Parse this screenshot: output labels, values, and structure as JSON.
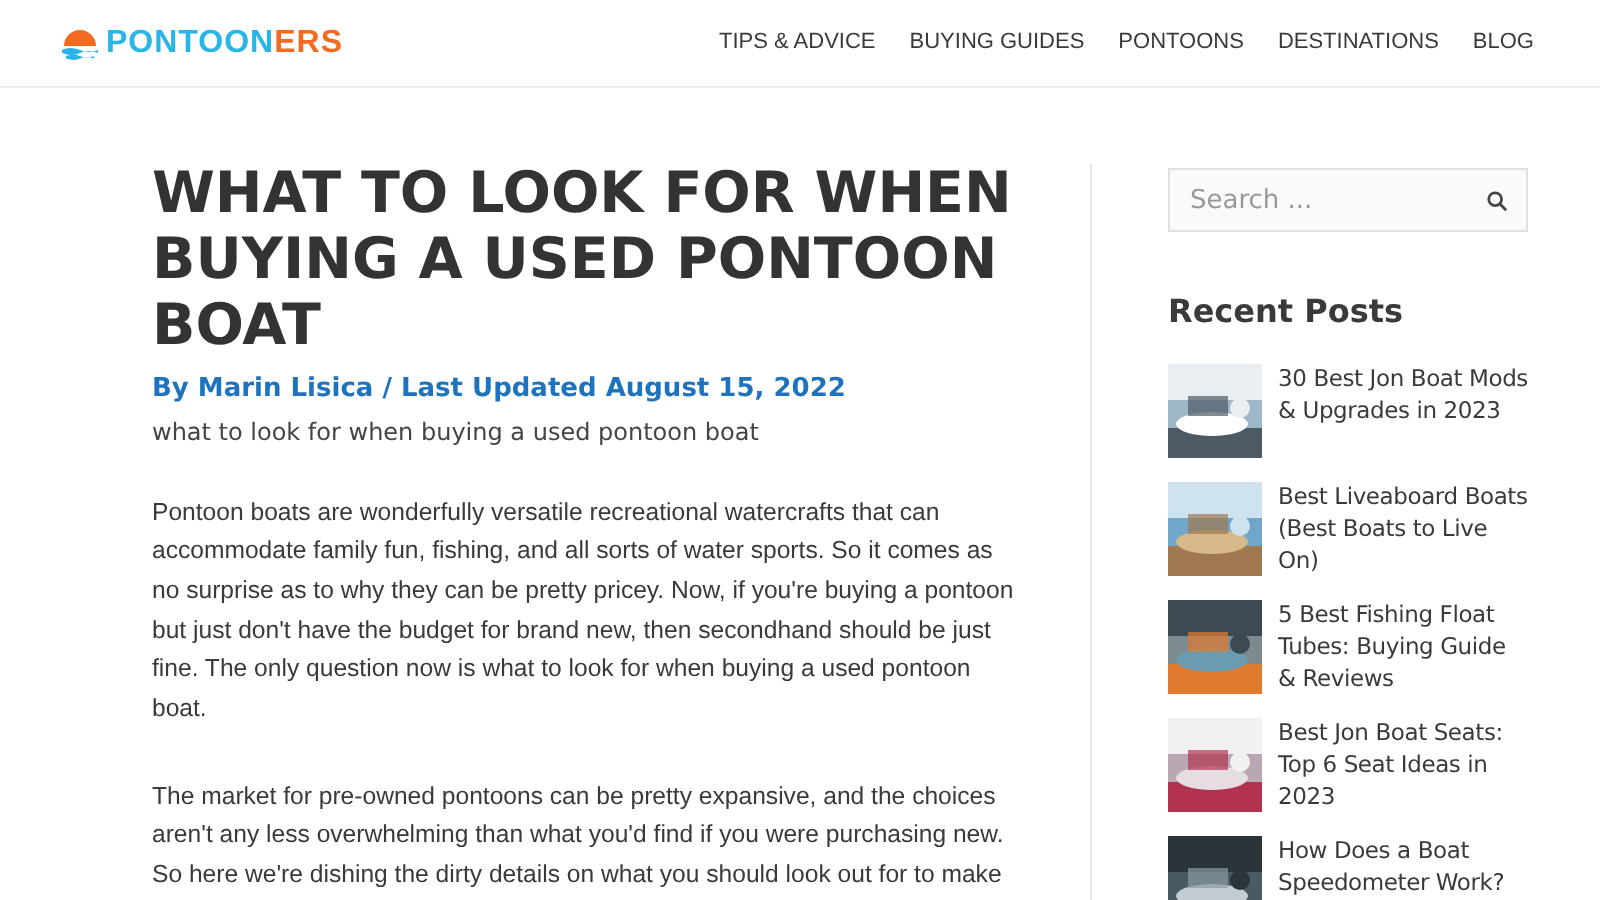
{
  "logo": {
    "part_1": "PONTOON",
    "part_2": "ERS"
  },
  "nav": [
    "TIPS & ADVICE",
    "BUYING GUIDES",
    "PONTOONS",
    "DESTINATIONS",
    "BLOG"
  ],
  "article": {
    "title": "WHAT TO LOOK FOR WHEN BUYING A USED PONTOON BOAT",
    "byline": "By Marin Lisica / Last Updated August 15, 2022",
    "caption": "what to look for when buying a used pontoon boat",
    "paragraphs": [
      "Pontoon boats are wonderfully versatile recreational watercrafts that can accommodate family fun, fishing, and all sorts of water sports. So it comes as no surprise as to why they can be pretty pricey. Now, if you're buying a pontoon but just don't have the budget for brand new, then secondhand should be just fine. The only question now is what to look for when buying a used pontoon boat.",
      "The market for pre-owned pontoons can be pretty expansive, and the choices aren't any less overwhelming than what you'd find if you were purchasing new. So here we're dishing the dirty details on what you should look out for to make"
    ]
  },
  "sidebar": {
    "search": {
      "placeholder": "Search ..."
    },
    "heading": "Recent Posts",
    "posts": [
      {
        "title": "30 Best Jon Boat Mods & Upgrades in 2023"
      },
      {
        "title": "Best Liveaboard Boats (Best Boats to Live On)"
      },
      {
        "title": "5 Best Fishing Float Tubes: Buying Guide & Reviews"
      },
      {
        "title": "Best Jon Boat Seats: Top 6 Seat Ideas in 2023"
      },
      {
        "title": "How Does a Boat Speedometer Work?"
      }
    ]
  }
}
